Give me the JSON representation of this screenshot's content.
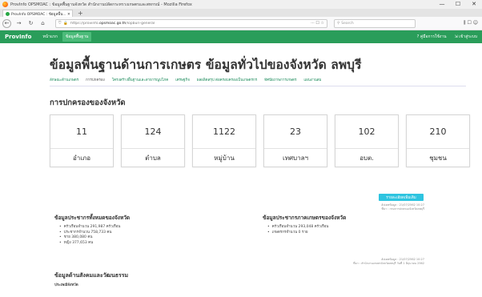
{
  "browser": {
    "window_title": "ProvInfo OPSMOAC : ข้อมูลพื้นฐานจังหวัด สำนักงานปลัดกระทรวงเกษตรและสหกรณ์ - Mozilla Firefox",
    "window_controls": [
      "—",
      "☐",
      "✕"
    ],
    "tab_title": "ProvInfo OPSMOAC : ข้อมูลพื้น... ✕",
    "new_tab": "+",
    "url_prefix": "https://provinfo.",
    "url_domain": "opsmoac.go.th",
    "url_suffix": "/lopburi-general",
    "url_actions": "··· ☐ ☆",
    "search_placeholder": "Search",
    "toolbar_icons": "⫼ ☐ ☺"
  },
  "site": {
    "brand": "ProvInfo",
    "nav": [
      {
        "label": "หน้าแรก",
        "active": false
      },
      {
        "label": "ข้อมูลพื้นฐาน",
        "active": true
      }
    ],
    "manual": "? คู่มือการใช้งาน",
    "login": "⇲ เข้าสู่ระบบ"
  },
  "page": {
    "title": "ข้อมูลพื้นฐานด้านการเกษตร ข้อมูลทั่วไปของจังหวัด ลพบุรี",
    "subnav": [
      {
        "label": "ลักษณะด้านเกษตร",
        "active": false
      },
      {
        "label": "การปกครอง",
        "active": true
      },
      {
        "label": "โครงสร้างพื้นฐานและสาธารณูปโภค",
        "active": false
      },
      {
        "label": "เศรษฐกิจ",
        "active": false
      },
      {
        "label": "ผลผลิตสรุป ต่อครอบครองเป็นเกษตรกร",
        "active": false
      },
      {
        "label": "ทัศนียภาพการเกษตร",
        "active": false
      },
      {
        "label": "แผนงานสม",
        "active": false
      }
    ],
    "section_title": "การปกครองของจังหวัด",
    "sub_title": "การแบ่งเขตการปกครอง",
    "cards": [
      {
        "value": "11",
        "label": "อำเภอ"
      },
      {
        "value": "124",
        "label": "ตำบล"
      },
      {
        "value": "1122",
        "label": "หมู่บ้าน"
      },
      {
        "value": "23",
        "label": "เทศบาลฯ"
      },
      {
        "value": "102",
        "label": "อบต."
      },
      {
        "value": "210",
        "label": "ชุมชน"
      }
    ],
    "more_button": "รายละเอียดเพิ่มเติม",
    "update1_line1": "อัปเดตข้อมูล : 21/07/2562 10:27",
    "update1_line2": "ที่มา : กรมการปกครองจังหวัดลพบุรี",
    "pop_all": {
      "title": "ข้อมูลประชากรทั้งหมดของจังหวัด",
      "items": [
        "ครัวเรือนจำนวน 291,987 ครัวเรือน",
        "ประชากรจำนวน 758,733 คน",
        "ชาย 380,080 คน",
        "หญิง 377,653 คน"
      ]
    },
    "pop_agri": {
      "title": "ข้อมูลประชากรภาคเกษตรของจังหวัด",
      "items": [
        "ครัวเรือนจำนวน 293,048 ครัวเรือน",
        "เกษตรกรจำนวน 0 ราย"
      ]
    },
    "update2_line1": "อัปเดตข้อมูล : 21/07/2562 10:27",
    "update2_line2": "ที่มา : สำนักงานเกษตรจังหวัดลพบุรี วันที่ 1 มิถุนายน 2562",
    "section2_title": "ข้อมูลด้านสังคมและวัฒนธรรม",
    "section2_sub": "ประเพณีจังหวัด"
  }
}
